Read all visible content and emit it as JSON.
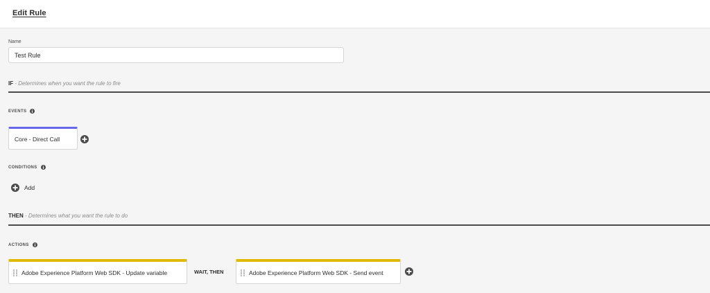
{
  "header": {
    "title": "Edit Rule"
  },
  "name_field": {
    "label": "Name",
    "value": "Test Rule"
  },
  "if_section": {
    "keyword": "IF",
    "description": "Determines when you want the rule to fire"
  },
  "events": {
    "label": "EVENTS",
    "items": [
      {
        "label": "Core - Direct Call",
        "accent": "#6767ec"
      }
    ]
  },
  "conditions": {
    "label": "CONDITIONS",
    "add_label": "Add"
  },
  "then_section": {
    "keyword": "THEN",
    "description": "Determines what you want the rule to do"
  },
  "actions": {
    "label": "ACTIONS",
    "items": [
      {
        "label": "Adobe Experience Platform Web SDK - Update variable",
        "accent": "#e1b900"
      },
      {
        "label": "Adobe Experience Platform Web SDK - Send event",
        "accent": "#e1b900"
      }
    ],
    "separator": "WAIT, THEN"
  },
  "icons": {
    "info": "info-icon",
    "add": "plus-circle-icon",
    "drag": "drag-handle-icon"
  }
}
